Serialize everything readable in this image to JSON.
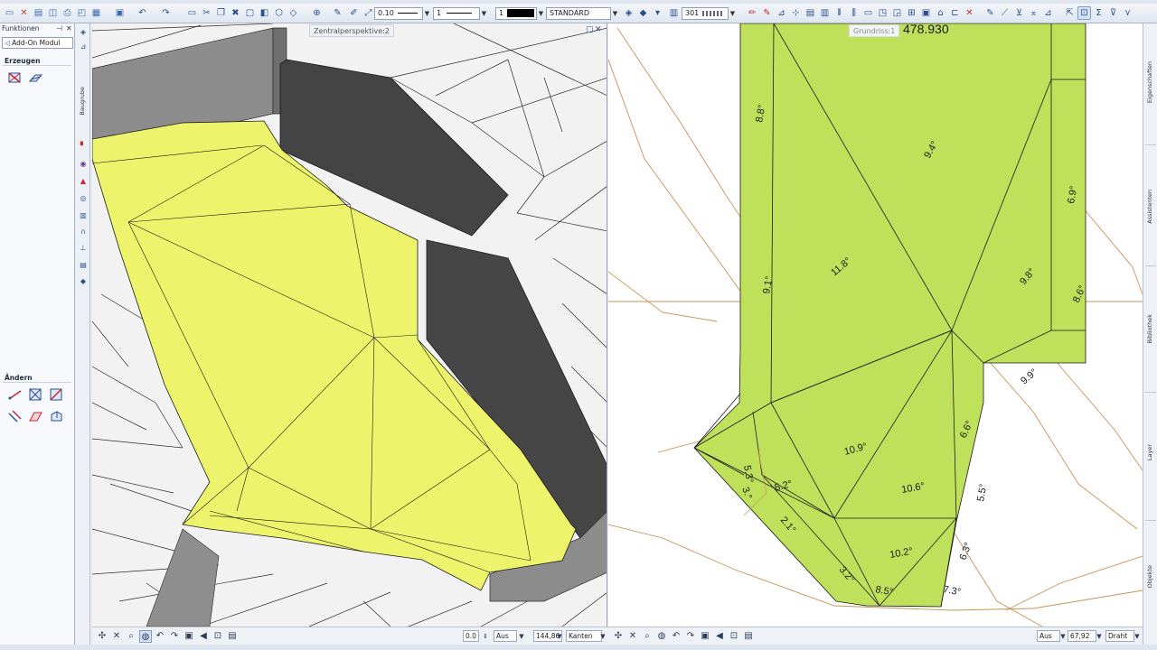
{
  "toolbar": {
    "pen_value": "0.10",
    "line_value": "1",
    "color_value": "1",
    "layer_value": "STANDARD",
    "scale_value": "301"
  },
  "left_panel": {
    "title": "Funktionen",
    "module_select": "Add-On Modul",
    "section_create": "Erzeugen",
    "section_modify": "Ändern",
    "vertical_label": "Baugrube"
  },
  "viewport_left": {
    "label": "Zentralperspektive:2",
    "status": {
      "value_field": "0.0",
      "mode": "Aus",
      "zoom": "144,86",
      "display": "Kanten"
    }
  },
  "viewport_right": {
    "label": "Grundriss:1",
    "elevation": "478.930",
    "slope_labels": [
      "8.8°",
      "9.4°",
      "6.9°",
      "9.1°",
      "11.8°",
      "9.8°",
      "8.6°",
      "9.9°",
      "5.3°",
      "10.9°",
      "6.6°",
      "5.2°",
      "3.°",
      "10.6°",
      "5.5°",
      "2.1°",
      "3.2°",
      "10.2°",
      "6.3°",
      "8.5°",
      "7.3°"
    ],
    "status": {
      "mode": "Aus",
      "zoom": "67,92",
      "display": "Draht"
    }
  },
  "right_strip": {
    "tabs": [
      "Eigenschaften",
      "Assistenten",
      "Bibliothek",
      "Layer",
      "Objekte"
    ]
  },
  "colors": {
    "perspective_fill": "#edf36b",
    "plan_fill": "#bfe05b",
    "wall_dark": "#444444",
    "wall_mid": "#8a8a8a",
    "contour": "#c89155"
  }
}
